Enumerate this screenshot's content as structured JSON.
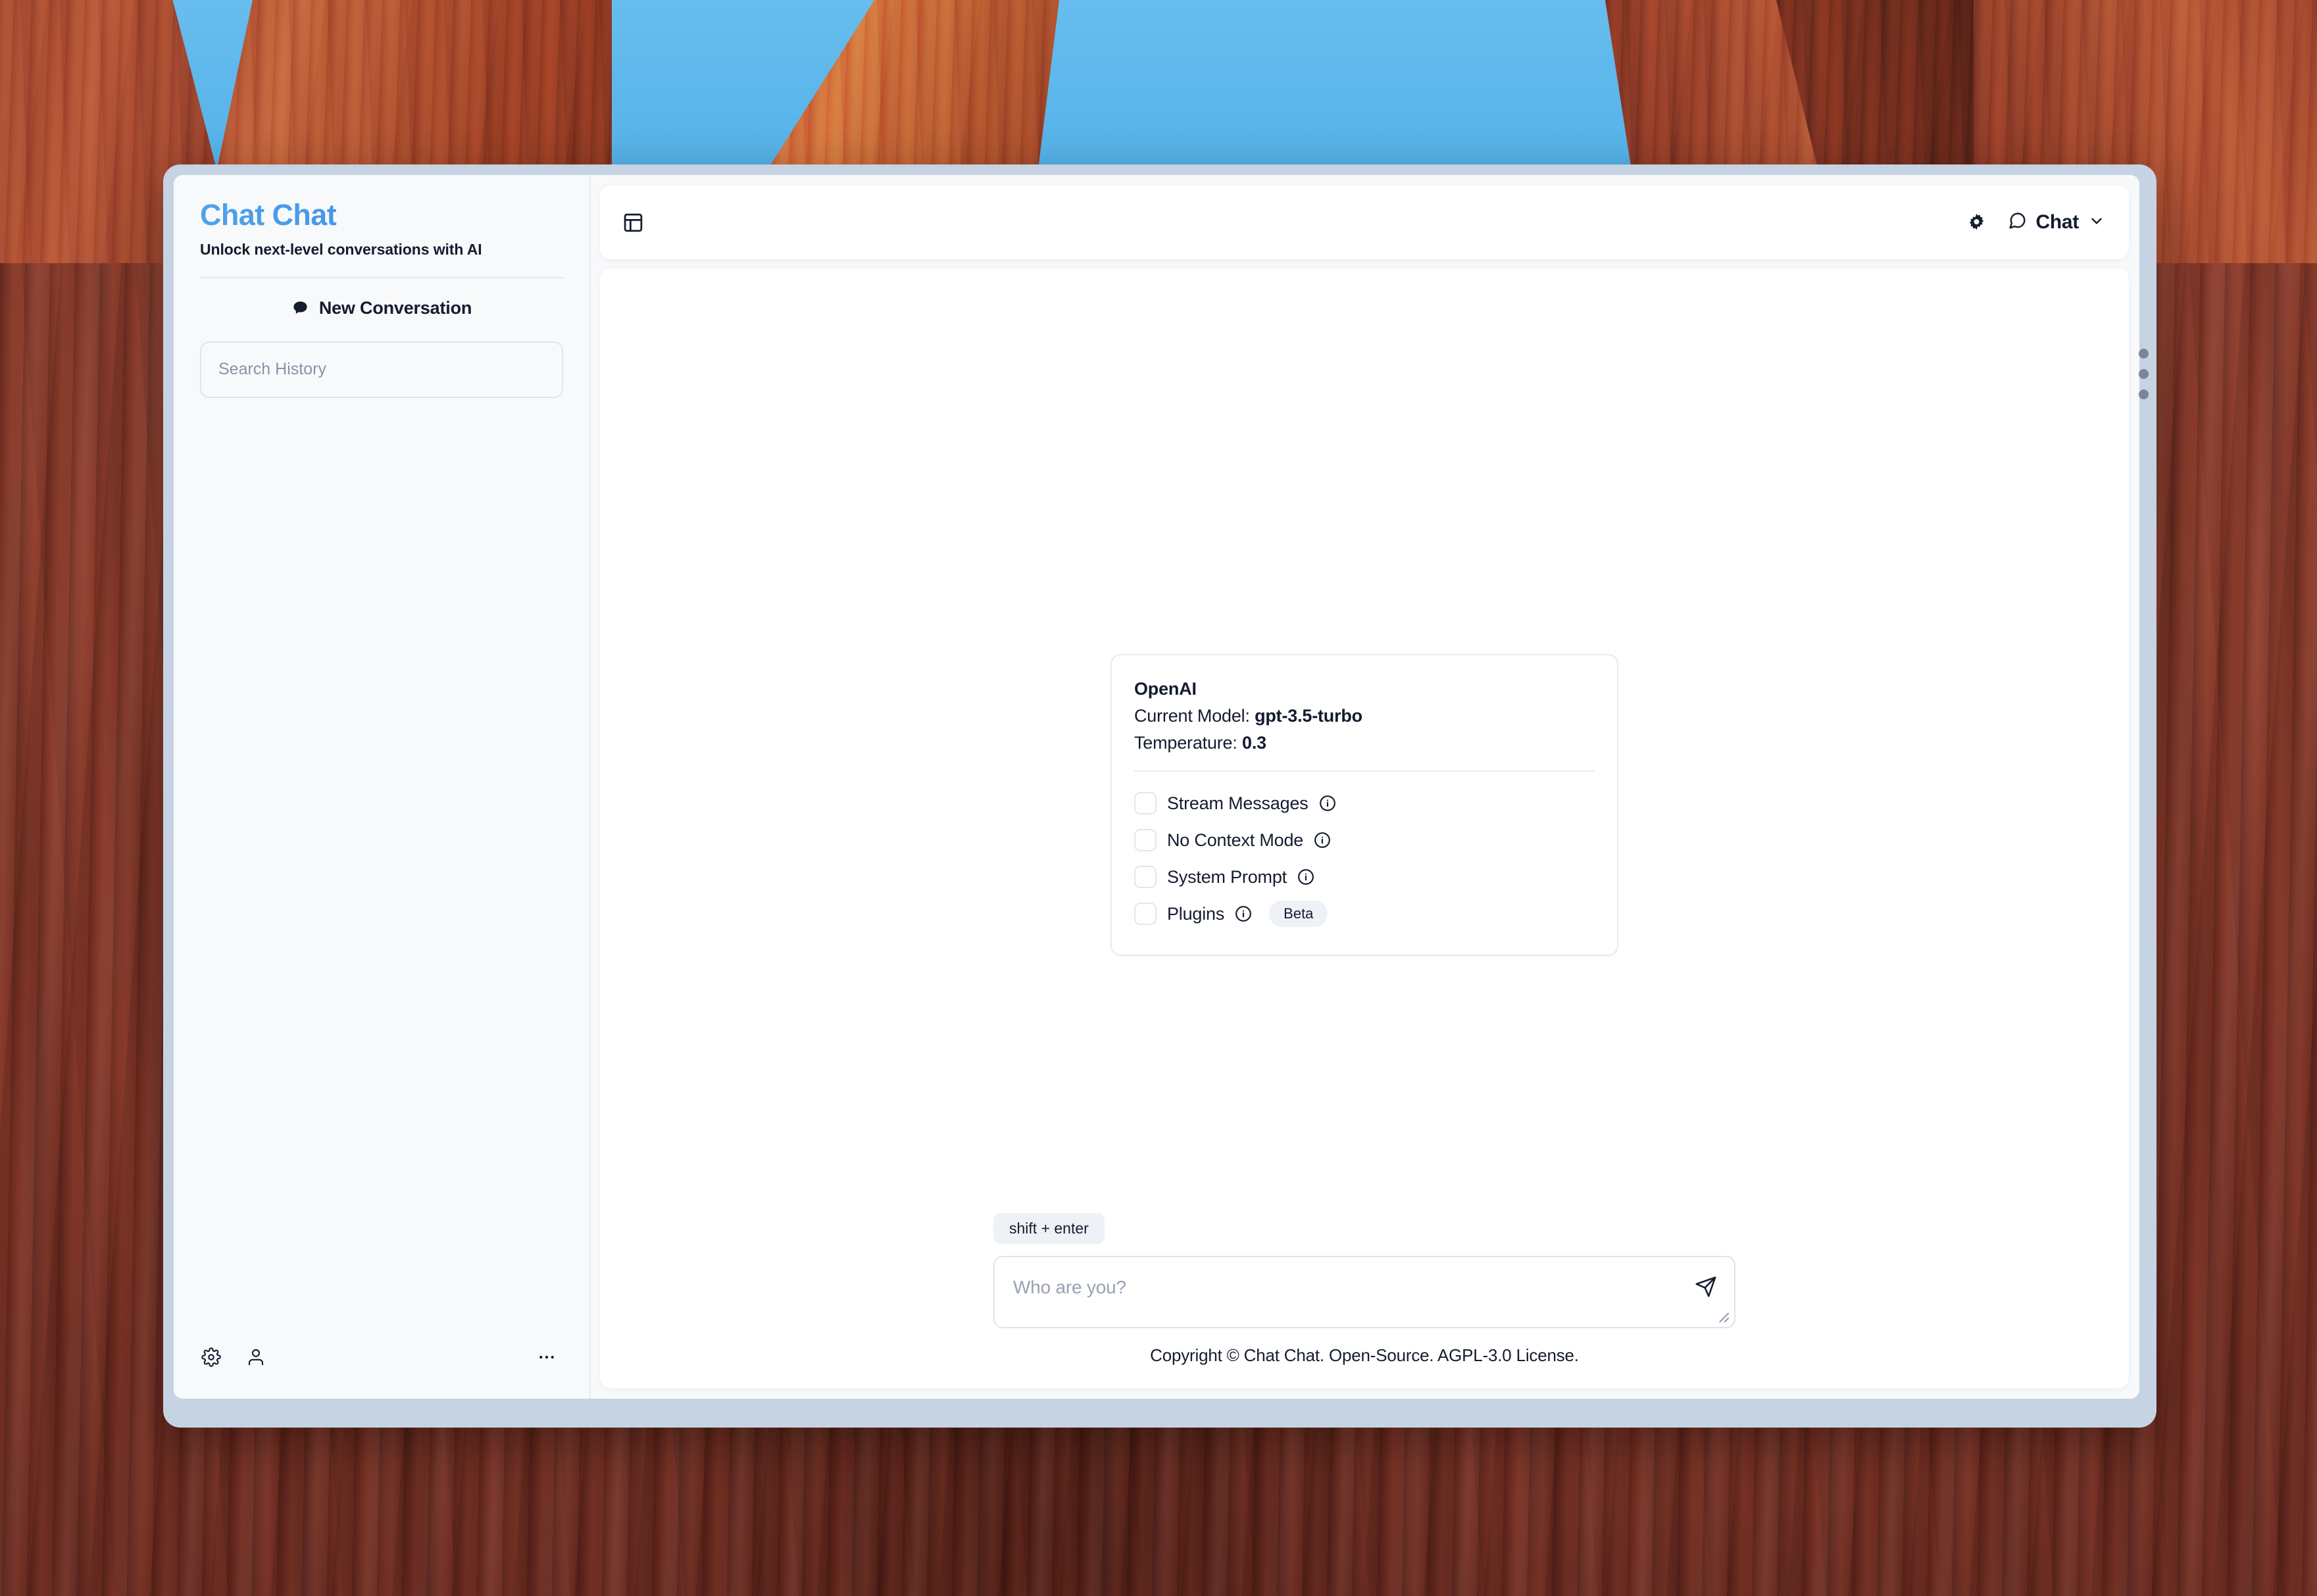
{
  "sidebar": {
    "app_title": "Chat Chat",
    "tagline": "Unlock next-level conversations with AI",
    "new_conversation_label": "New Conversation",
    "search_placeholder": "Search History",
    "search_value": "",
    "footer_icons": [
      "gear-icon",
      "user-icon",
      "more-horizontal-icon"
    ]
  },
  "topbar": {
    "panel_toggle_icon": "layout-panel-icon",
    "settings_icon": "gear-filled-icon",
    "mode_icon": "chat-bubble-icon",
    "mode_label": "Chat",
    "mode_caret_icon": "chevron-down-icon"
  },
  "settings_card": {
    "provider": "OpenAI",
    "model_key": "Current Model:",
    "model_value": "gpt-3.5-turbo",
    "temperature_key": "Temperature:",
    "temperature_value": "0.3",
    "options": [
      {
        "label": "Stream Messages",
        "checked": false,
        "info_icon": "info-icon",
        "badge": ""
      },
      {
        "label": "No Context Mode",
        "checked": false,
        "info_icon": "info-icon",
        "badge": ""
      },
      {
        "label": "System Prompt",
        "checked": false,
        "info_icon": "info-icon",
        "badge": ""
      },
      {
        "label": "Plugins",
        "checked": false,
        "info_icon": "info-icon",
        "badge": "Beta"
      }
    ]
  },
  "composer": {
    "hint_badge": "shift + enter",
    "placeholder": "Who are you?",
    "value": "",
    "send_icon": "send-icon"
  },
  "footer": {
    "copyright": "Copyright © Chat Chat. Open-Source. AGPL-3.0 License."
  },
  "colors": {
    "brand_start": "#4fa3ea",
    "brand_end": "#3d82e2",
    "text": "#141c2e",
    "muted": "#8a93a5",
    "sidebar_bg": "#f7f9fb",
    "card_bg": "#ffffff",
    "window_frame": "#c6d3e3",
    "badge_bg": "#eef1f6"
  }
}
